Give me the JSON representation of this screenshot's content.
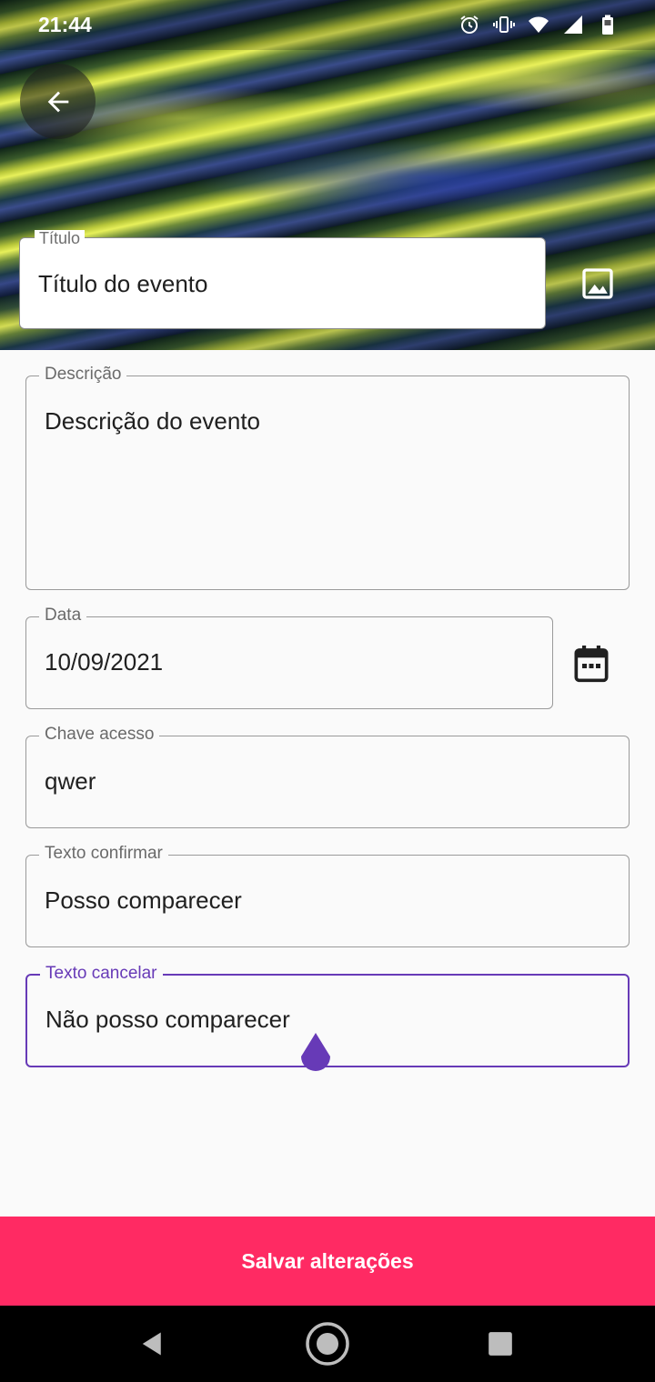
{
  "status_bar": {
    "time": "21:44",
    "icons": [
      "alarm-icon",
      "vibrate-icon",
      "wifi-icon",
      "signal-icon",
      "battery-icon"
    ]
  },
  "header": {
    "back_icon": "arrow-back-icon",
    "title_field": {
      "label": "Título",
      "value": "Título do evento"
    },
    "image_icon": "image-icon"
  },
  "form": {
    "description": {
      "label": "Descrição",
      "value": "Descrição do evento"
    },
    "date": {
      "label": "Data",
      "value": "10/09/2021",
      "icon": "calendar-icon"
    },
    "access_key": {
      "label": "Chave acesso",
      "value": "qwer"
    },
    "confirm_text": {
      "label": "Texto confirmar",
      "value": "Posso comparecer"
    },
    "cancel_text": {
      "label": "Texto cancelar",
      "value": "Não posso comparecer",
      "focused": true
    }
  },
  "footer": {
    "save_label": "Salvar alterações"
  },
  "colors": {
    "accent": "#673ab7",
    "save_button": "#ff2a63"
  },
  "nav_bar": {
    "icons": [
      "back-triangle-icon",
      "home-circle-icon",
      "recents-square-icon"
    ]
  }
}
